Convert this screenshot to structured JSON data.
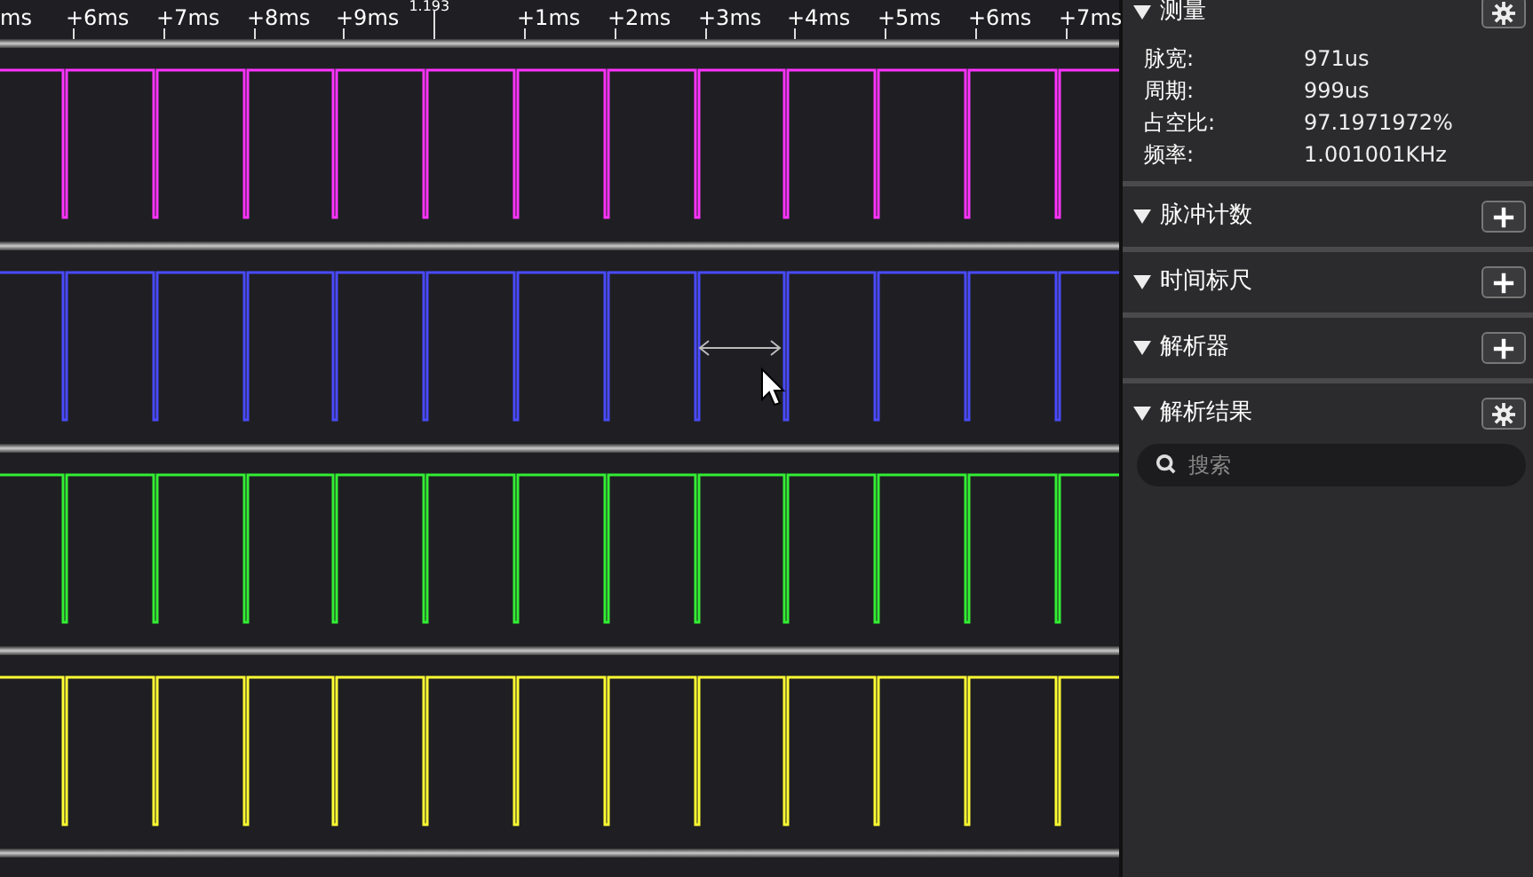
{
  "ruler": {
    "labels": [
      "ms",
      "+6ms",
      "+7ms",
      "+8ms",
      "+9ms",
      "+1ms",
      "+2ms",
      "+3ms",
      "+4ms",
      "+5ms",
      "+6ms",
      "+7ms"
    ],
    "marker": "1.193"
  },
  "channels": [
    {
      "color": "#ff33ff"
    },
    {
      "color": "#4a4aff"
    },
    {
      "color": "#33ee33"
    },
    {
      "color": "#ffff33"
    }
  ],
  "panel": {
    "sections": [
      {
        "title": "测量",
        "kind": "settings",
        "rows": [
          {
            "label": "脉宽:",
            "value": "971us"
          },
          {
            "label": "周期:",
            "value": "999us"
          },
          {
            "label": "占空比:",
            "value": "97.1971972%"
          },
          {
            "label": "频率:",
            "value": "1.001001KHz"
          }
        ]
      },
      {
        "title": "脉冲计数",
        "kind": "add"
      },
      {
        "title": "时间标尺",
        "kind": "add"
      },
      {
        "title": "解析器",
        "kind": "add"
      },
      {
        "title": "解析结果",
        "kind": "settings",
        "search": {
          "placeholder": "搜索"
        }
      }
    ]
  }
}
